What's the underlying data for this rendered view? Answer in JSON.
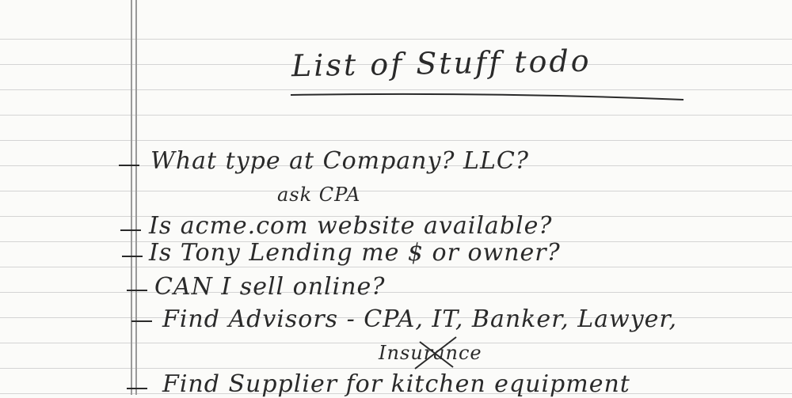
{
  "document": {
    "title": "List of Stuff todo",
    "items": [
      {
        "text": "What type at Company? LLC?"
      },
      {
        "text": "ask CPA"
      },
      {
        "text": "Is acme.com website available?"
      },
      {
        "text": "Is Tony Lending me $ or owner?"
      },
      {
        "text": "CAN I sell online?"
      },
      {
        "text": "Find Advisors - CPA, IT, Banker, Lawyer,"
      },
      {
        "text": "Insurance"
      },
      {
        "text": "Find Supplier for kitchen equipment"
      }
    ]
  }
}
